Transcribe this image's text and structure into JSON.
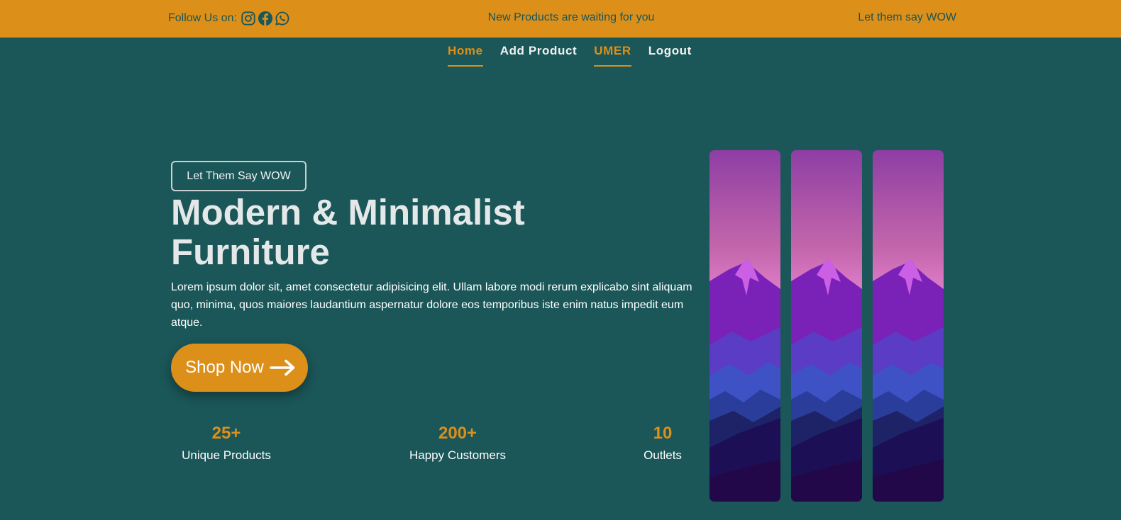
{
  "topbar": {
    "follow_label": "Follow Us on:",
    "social_icons": [
      "instagram-icon",
      "facebook-icon",
      "whatsapp-icon"
    ],
    "center_message": "New Products are waiting for you",
    "right_message": "Let them say WOW"
  },
  "nav": {
    "items": [
      {
        "label": "Home",
        "active": true
      },
      {
        "label": "Add Product",
        "active": false
      },
      {
        "label": "UMER",
        "active": true
      },
      {
        "label": "Logout",
        "active": false
      }
    ]
  },
  "hero": {
    "tagline": "Let Them Say WOW",
    "title": "Modern & Minimalist Furniture",
    "description": "Lorem ipsum dolor sit, amet consectetur adipisicing elit. Ullam labore modi rerum explicabo sint aliquam quo, minima, quos maiores laudantium aspernatur dolore eos temporibus iste enim natus impedit eum atque.",
    "cta_label": "Shop Now",
    "cta_icon": "arrow-right-icon"
  },
  "stats": [
    {
      "value": "25+",
      "label": "Unique Products"
    },
    {
      "value": "200+",
      "label": "Happy Customers"
    },
    {
      "value": "10",
      "label": "Outlets"
    }
  ],
  "colors": {
    "background": "#1b5658",
    "accent": "#dc901a",
    "text_light": "#ffffff"
  }
}
